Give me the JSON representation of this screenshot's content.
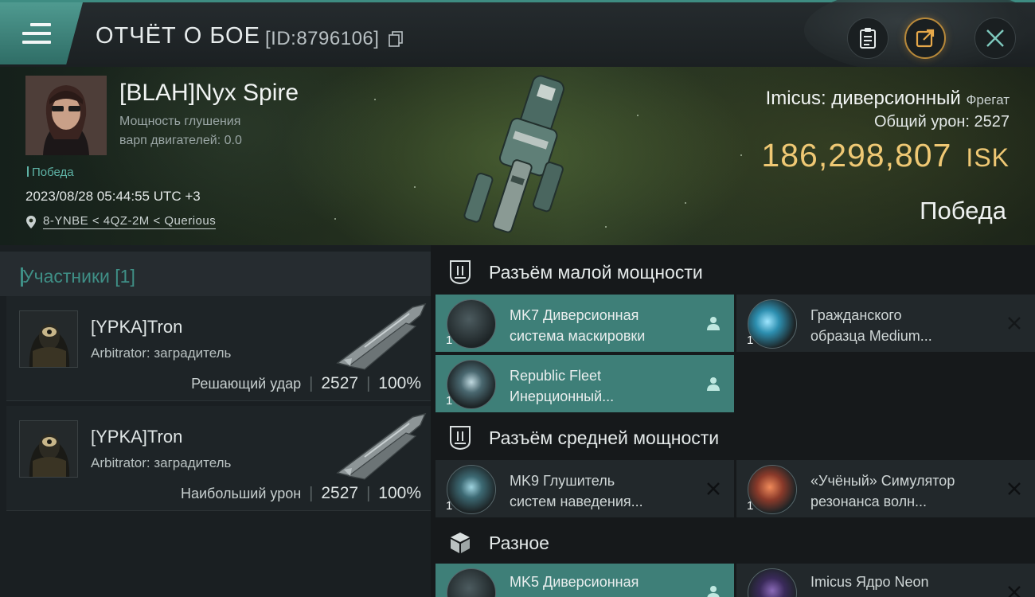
{
  "header": {
    "title": "ОТЧЁТ О БОЕ",
    "report_id": "[ID:8796106]",
    "icons": [
      "menu-icon",
      "copy-icon",
      "notes-icon",
      "export-icon",
      "close-icon"
    ]
  },
  "victim": {
    "pilot_name": "[BLAH]Nyx Spire",
    "stat_line1": "Мощность глушения",
    "stat_line2": "варп двигателей: 0.0",
    "tag": "Победа",
    "timestamp": "2023/08/28 05:44:55 UTC +3",
    "location": "8-YNBE < 4QZ-2M < Querious",
    "ship_name": "Imicus: диверсионный",
    "ship_class": "Фрегат",
    "total_damage_label": "Общий урон: 2527",
    "isk_value": "186,298,807",
    "isk_unit": "ISK",
    "result": "Победа"
  },
  "participants": {
    "tab_label": "Участники [1]",
    "items": [
      {
        "name": "[YPKA]Tron",
        "ship": "Arbitrator: заградитель",
        "role": "Решающий удар",
        "damage": "2527",
        "percent": "100%"
      },
      {
        "name": "[YPKA]Tron",
        "ship": "Arbitrator: заградитель",
        "role": "Наибольший урон",
        "damage": "2527",
        "percent": "100%"
      }
    ]
  },
  "fitting": {
    "low_slot": {
      "title": "Разъём малой мощности",
      "modules": [
        {
          "name_line1": "MK7 Диверсионная",
          "name_line2": "система маскировки",
          "qty": "1",
          "state": "fitted"
        },
        {
          "name_line1": "Гражданского",
          "name_line2": "образца Medium...",
          "qty": "1",
          "state": "destroyed"
        },
        {
          "name_line1": "Republic Fleet",
          "name_line2": "Инерционный...",
          "qty": "1",
          "state": "fitted"
        }
      ]
    },
    "mid_slot": {
      "title": "Разъём средней мощности",
      "modules": [
        {
          "name_line1": "MK9 Глушитель",
          "name_line2": "систем наведения...",
          "qty": "1",
          "state": "destroyed"
        },
        {
          "name_line1": "«Учёный» Симулятор",
          "name_line2": "резонанса волн...",
          "qty": "1",
          "state": "destroyed"
        }
      ]
    },
    "misc": {
      "title": "Разное",
      "modules": [
        {
          "name_line1": "MK5 Диверсионная",
          "name_line2": "",
          "qty": "1",
          "state": "fitted"
        },
        {
          "name_line1": "Imicus Ядро Neon",
          "name_line2": "",
          "qty": "1",
          "state": "destroyed"
        }
      ]
    }
  },
  "colors": {
    "accent_teal": "#3e7f78",
    "isk_gold": "#efc874",
    "victory_teal": "#5eb3a6"
  }
}
